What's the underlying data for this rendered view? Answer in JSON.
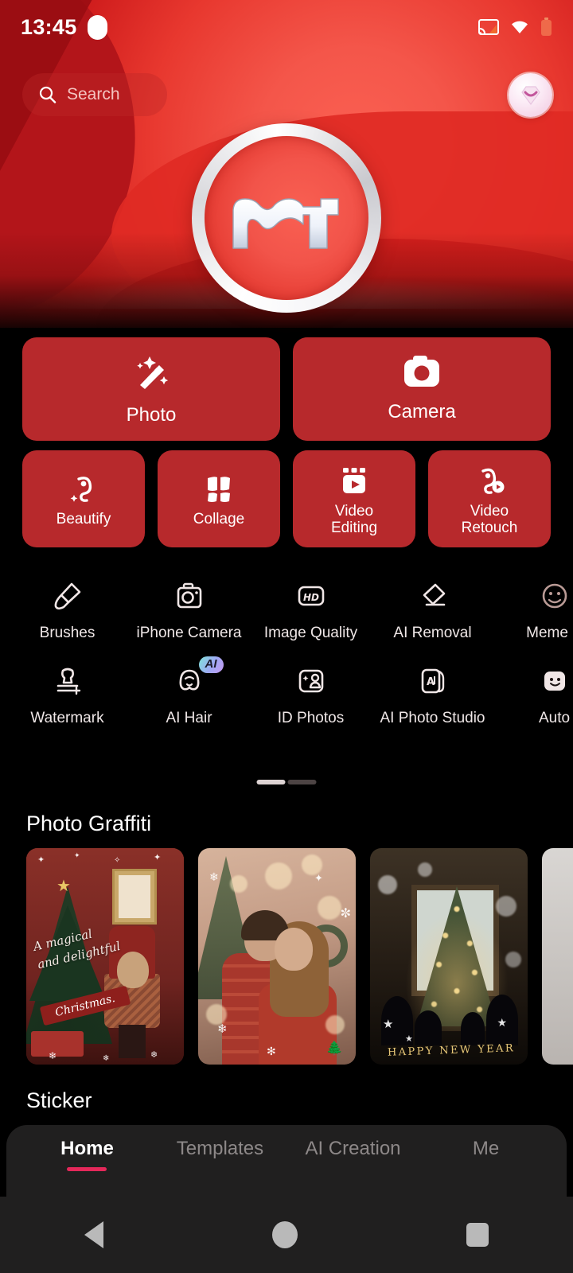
{
  "status_bar": {
    "time": "13:45",
    "icons": [
      "cast-icon",
      "wifi-icon",
      "battery-icon"
    ]
  },
  "search": {
    "placeholder": "Search",
    "icon": "search-icon"
  },
  "profile": {
    "icon": "vip-diamond-avatar"
  },
  "banner": {
    "logo_alt": "MT",
    "accent_red": "#e8382f",
    "deep_red": "#b01414"
  },
  "primary_actions": [
    {
      "label": "Photo",
      "icon": "magic-wand-icon"
    },
    {
      "label": "Camera",
      "icon": "camera-icon"
    }
  ],
  "secondary_actions": [
    {
      "label": "Beautify",
      "icon": "face-beautify-icon"
    },
    {
      "label": "Collage",
      "icon": "collage-icon"
    },
    {
      "label": "Video\nEditing",
      "icon": "video-editing-icon"
    },
    {
      "label": "Video\nRetouch",
      "icon": "video-retouch-icon"
    }
  ],
  "tools": {
    "row1": [
      {
        "label": "Brushes",
        "icon": "paintbrush-icon",
        "badge": null
      },
      {
        "label": "iPhone Camera",
        "icon": "camera-outline-icon",
        "badge": null
      },
      {
        "label": "Image Quality",
        "icon": "hd-icon",
        "badge": null
      },
      {
        "label": "AI Removal",
        "icon": "eraser-icon",
        "badge": null
      },
      {
        "label": "Meme E",
        "icon": "meme-face-icon",
        "badge": null
      }
    ],
    "row2": [
      {
        "label": "Watermark",
        "icon": "watermark-stamp-icon",
        "badge": null
      },
      {
        "label": "AI Hair",
        "icon": "ai-hair-icon",
        "badge": "AI"
      },
      {
        "label": "ID Photos",
        "icon": "id-photo-icon",
        "badge": null
      },
      {
        "label": "AI Photo Studio",
        "icon": "ai-photo-studio-icon",
        "badge": null
      },
      {
        "label": "Auto",
        "icon": "smiley-sticker-icon",
        "badge": null
      }
    ],
    "pager": {
      "pages": 2,
      "active": 0
    }
  },
  "sections": [
    {
      "title": "Photo Graffiti"
    },
    {
      "title": "Sticker"
    }
  ],
  "graffiti_cards": [
    {
      "name": "christmas-girl-card",
      "overlay_text_lines": [
        "A  magical",
        "and  delightful"
      ],
      "ribbon_text": "Christmas."
    },
    {
      "name": "christmas-couple-card",
      "overlay_text_lines": [],
      "ribbon_text": ""
    },
    {
      "name": "family-tree-card",
      "overlay_text_lines": [],
      "ribbon_text": "HAPPY NEW YEAR"
    },
    {
      "name": "partial-card",
      "overlay_text_lines": [],
      "ribbon_text": ""
    }
  ],
  "bottom_nav": {
    "items": [
      {
        "label": "Home",
        "active": true
      },
      {
        "label": "Templates",
        "active": false
      },
      {
        "label": "AI Creation",
        "active": false
      },
      {
        "label": "Me",
        "active": false
      }
    ],
    "active_color": "#e4285a"
  },
  "system_nav": {
    "back": "back-triangle-icon",
    "home": "home-circle-icon",
    "recents": "recents-square-icon"
  }
}
